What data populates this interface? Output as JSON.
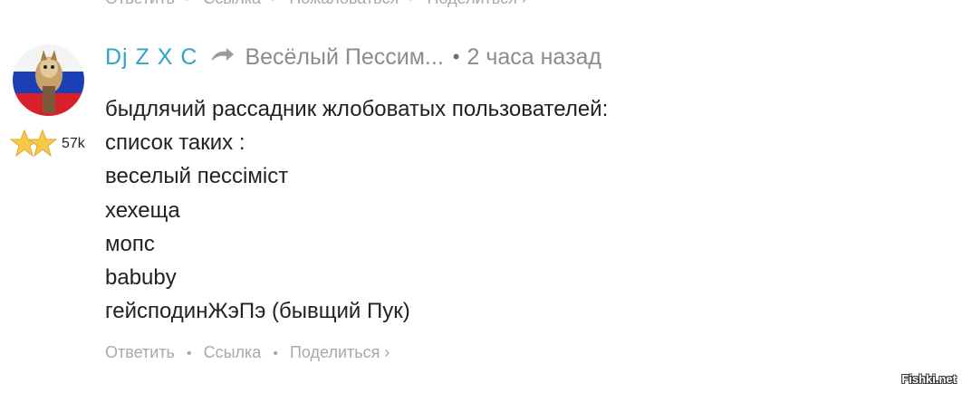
{
  "previous_comment": {
    "actions": [
      "Ответить",
      "Ссылка",
      "Пожаловаться",
      "Поделиться ›"
    ]
  },
  "comment": {
    "author": "Dj Z X C",
    "reply_to": "Весёлый Пессим...",
    "separator": "•",
    "time_ago": "2 часа назад",
    "karma": "57k",
    "lines": [
      "быдлячий рассадник жлобоватых пользователей:",
      "список таких :",
      "веселый пессiмiст",
      "хехеща",
      "мопс",
      "babuby",
      "гейсподинЖэПэ (бывщий Пук)"
    ],
    "actions": {
      "reply": "Ответить",
      "link": "Ссылка",
      "share": "Поделиться ›",
      "dot": "•"
    }
  },
  "icons": {
    "reply": "reply-arrow-icon",
    "stars": "star-icon"
  },
  "colors": {
    "author": "#2fa4c7",
    "muted": "#8c8c8c",
    "actions": "#a8a8a8",
    "star": "#f7c948"
  },
  "watermark": "Fishki.net"
}
